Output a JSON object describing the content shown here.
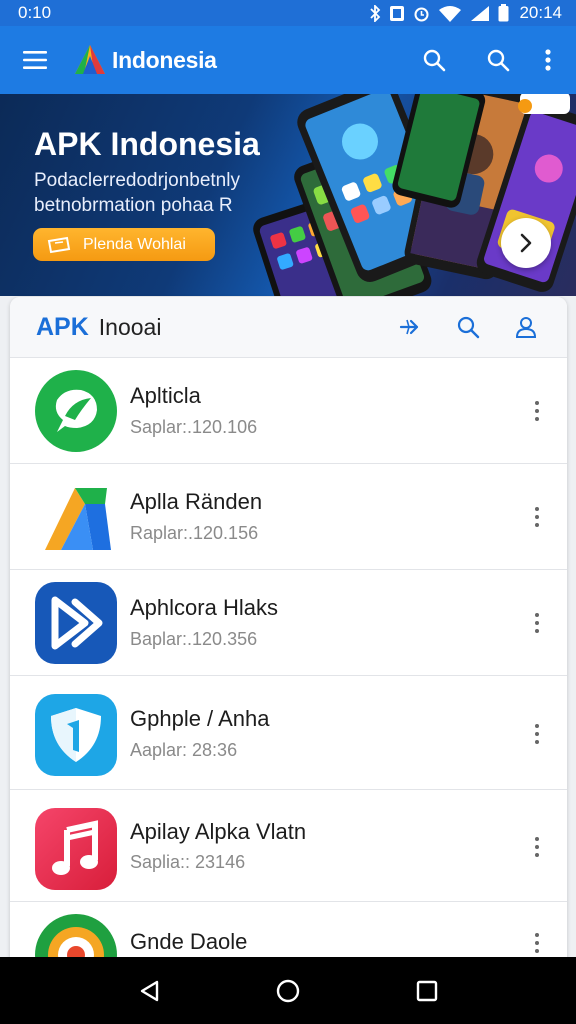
{
  "status": {
    "time": "0:10",
    "clock_right": "20:14"
  },
  "appbar": {
    "title": "Indonesia"
  },
  "banner": {
    "title": "APK Indonesia",
    "subtitle_line1": "Podaclerredodrjonbetnly",
    "subtitle_line2": "betnobrmation pohaa R",
    "cta_label": "Plenda Wohlai"
  },
  "card_header": {
    "brand": "APK",
    "subtitle": "Inooai"
  },
  "apps": [
    {
      "name": "Aplticla",
      "meta": "Saplar:.120.106",
      "icon": "chat-bubble-icon",
      "color": "#1fb14a"
    },
    {
      "name": "Aplla Ränden",
      "meta": "Raplar:.120.156",
      "icon": "triangle-a-icon",
      "color": "#ffffff"
    },
    {
      "name": "Aphlcora Hlaks",
      "meta": "Baplar:.120.356",
      "icon": "play-forward-icon",
      "color": "#1758b8"
    },
    {
      "name": "Gphple / Anha",
      "meta": "Aaplar: 28:36",
      "icon": "shield-icon",
      "color": "#1ea6e6"
    },
    {
      "name": "Apilay Alpka Vlatn",
      "meta": "Saplia:: 23146",
      "icon": "music-note-icon",
      "color": "#e8324d"
    },
    {
      "name": "Gnde Daole",
      "meta": "",
      "icon": "target-icon",
      "color": "#1fa040"
    }
  ]
}
